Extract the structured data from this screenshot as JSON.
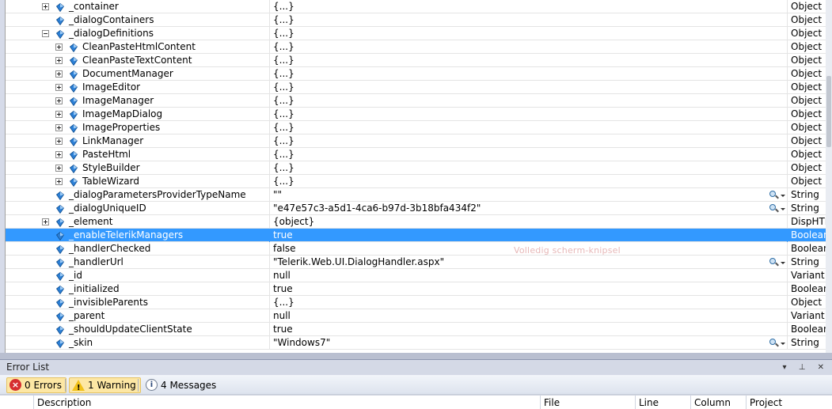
{
  "watch": {
    "rows": [
      {
        "expander": "plus",
        "name": "_container",
        "value": "{...}",
        "type": "Object",
        "level": 1
      },
      {
        "expander": "",
        "name": "_dialogContainers",
        "value": "{...}",
        "type": "Object",
        "level": 1
      },
      {
        "expander": "minus",
        "name": "_dialogDefinitions",
        "value": "{...}",
        "type": "Object",
        "level": 1
      },
      {
        "expander": "plus",
        "name": "CleanPasteHtmlContent",
        "value": "{...}",
        "type": "Object",
        "level": 2
      },
      {
        "expander": "plus",
        "name": "CleanPasteTextContent",
        "value": "{...}",
        "type": "Object",
        "level": 2
      },
      {
        "expander": "plus",
        "name": "DocumentManager",
        "value": "{...}",
        "type": "Object",
        "level": 2
      },
      {
        "expander": "plus",
        "name": "ImageEditor",
        "value": "{...}",
        "type": "Object",
        "level": 2
      },
      {
        "expander": "plus",
        "name": "ImageManager",
        "value": "{...}",
        "type": "Object",
        "level": 2
      },
      {
        "expander": "plus",
        "name": "ImageMapDialog",
        "value": "{...}",
        "type": "Object",
        "level": 2
      },
      {
        "expander": "plus",
        "name": "ImageProperties",
        "value": "{...}",
        "type": "Object",
        "level": 2
      },
      {
        "expander": "plus",
        "name": "LinkManager",
        "value": "{...}",
        "type": "Object",
        "level": 2
      },
      {
        "expander": "plus",
        "name": "PasteHtml",
        "value": "{...}",
        "type": "Object",
        "level": 2
      },
      {
        "expander": "plus",
        "name": "StyleBuilder",
        "value": "{...}",
        "type": "Object",
        "level": 2
      },
      {
        "expander": "plus",
        "name": "TableWizard",
        "value": "{...}",
        "type": "Object",
        "level": 2
      },
      {
        "expander": "",
        "name": "_dialogParametersProviderTypeName",
        "value": "\"\"",
        "type": "String",
        "level": 1,
        "visualizer": true
      },
      {
        "expander": "",
        "name": "_dialogUniqueID",
        "value": "\"e47e57c3-a5d1-4ca6-b97d-3b18bfa434f2\"",
        "type": "String",
        "level": 1,
        "visualizer": true
      },
      {
        "expander": "plus",
        "name": "_element",
        "value": "{object}",
        "type": "DispHTM",
        "level": 1
      },
      {
        "expander": "",
        "name": "_enableTelerikManagers",
        "value": "true",
        "type": "Boolean",
        "level": 1,
        "selected": true
      },
      {
        "expander": "",
        "name": "_handlerChecked",
        "value": "false",
        "type": "Boolean",
        "level": 1
      },
      {
        "expander": "",
        "name": "_handlerUrl",
        "value": "\"Telerik.Web.UI.DialogHandler.aspx\"",
        "type": "String",
        "level": 1,
        "visualizer": true
      },
      {
        "expander": "",
        "name": "_id",
        "value": "null",
        "type": "Variant",
        "level": 1
      },
      {
        "expander": "",
        "name": "_initialized",
        "value": "true",
        "type": "Boolean",
        "level": 1
      },
      {
        "expander": "",
        "name": "_invisibleParents",
        "value": "{...}",
        "type": "Object",
        "level": 1
      },
      {
        "expander": "",
        "name": "_parent",
        "value": "null",
        "type": "Variant",
        "level": 1
      },
      {
        "expander": "",
        "name": "_shouldUpdateClientState",
        "value": "true",
        "type": "Boolean",
        "level": 1
      },
      {
        "expander": "",
        "name": "_skin",
        "value": "\"Windows7\"",
        "type": "String",
        "level": 1,
        "visualizer": true
      }
    ],
    "watermark": "Volledig scherm-knipsel"
  },
  "error_list": {
    "title": "Error List",
    "title_buttons": "▾ ⊥ ✕",
    "errors_label": "0 Errors",
    "warnings_label": "1 Warning",
    "messages_label": "4 Messages",
    "columns": [
      "Description",
      "File",
      "Line",
      "Column",
      "Project"
    ]
  }
}
